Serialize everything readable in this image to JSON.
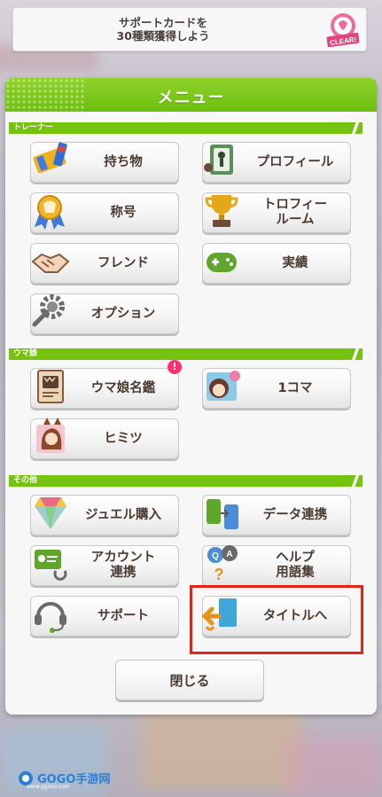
{
  "mission": {
    "line1": "サポートカードを",
    "line2": "30種類獲得しよう",
    "badge": "CLEAR!"
  },
  "menu": {
    "title": "メニュー"
  },
  "sections": {
    "trainer": {
      "label": "トレーナー",
      "items": [
        {
          "label": "持ち物",
          "icon": "inventory-icon"
        },
        {
          "label": "プロフィール",
          "icon": "profile-icon"
        },
        {
          "label": "称号",
          "icon": "title-medal-icon"
        },
        {
          "label": "トロフィー\nルーム",
          "icon": "trophy-icon"
        },
        {
          "label": "フレンド",
          "icon": "handshake-icon"
        },
        {
          "label": "実績",
          "icon": "gamepad-icon"
        },
        {
          "label": "オプション",
          "icon": "gear-icon"
        }
      ]
    },
    "umamusume": {
      "label": "ウマ娘",
      "items": [
        {
          "label": "ウマ娘名鑑",
          "icon": "encyclopedia-icon",
          "badge": "!"
        },
        {
          "label": "1コマ",
          "icon": "character-portrait-icon"
        },
        {
          "label": "ヒミツ",
          "icon": "secret-card-icon"
        }
      ]
    },
    "other": {
      "label": "その他",
      "items": [
        {
          "label": "ジュエル購入",
          "icon": "jewel-icon"
        },
        {
          "label": "データ連携",
          "icon": "data-link-icon"
        },
        {
          "label": "アカウント\n連携",
          "icon": "account-link-icon"
        },
        {
          "label": "ヘルプ\n用語集",
          "icon": "help-icon"
        },
        {
          "label": "サポート",
          "icon": "headset-icon"
        },
        {
          "label": "タイトルへ",
          "icon": "exit-door-icon"
        }
      ]
    }
  },
  "close_label": "閉じる",
  "watermark": {
    "brand": "GOGO手游网",
    "url": "www.ggsoo.com"
  },
  "colors": {
    "accent_green": "#76c30f",
    "highlight_red": "#e2231a",
    "text_brown": "#4a3a30"
  }
}
